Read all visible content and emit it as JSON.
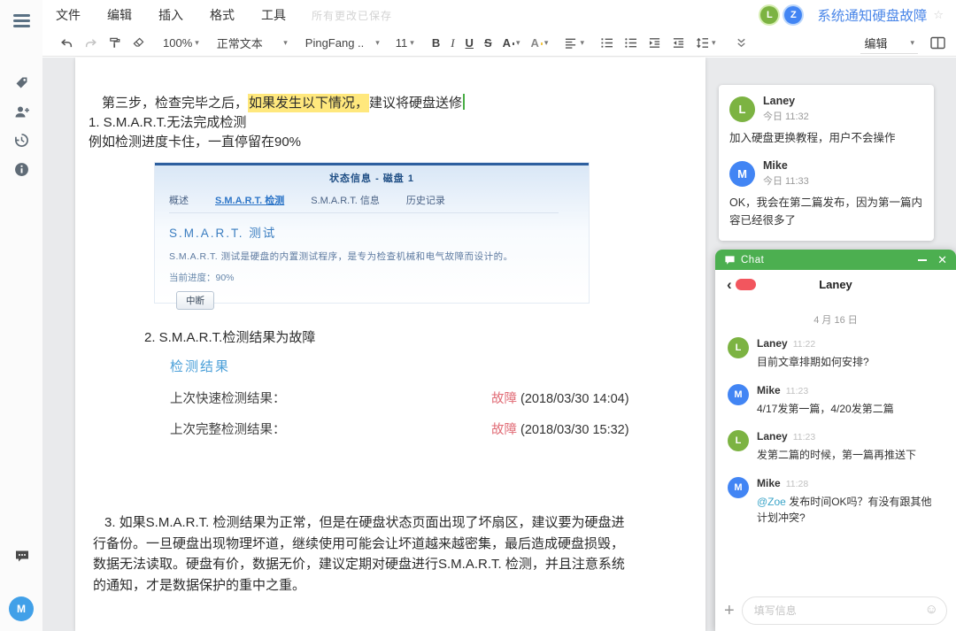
{
  "menu": {
    "items": [
      "文件",
      "编辑",
      "插入",
      "格式",
      "工具"
    ],
    "save_status": "所有更改已保存"
  },
  "titlebar": {
    "title": "系统通知硬盘故障",
    "collaborators": [
      {
        "initial": "L"
      },
      {
        "initial": "Z"
      }
    ]
  },
  "toolbar": {
    "zoom": "100%",
    "paragraph_style": "正常文本",
    "font_family": "PingFang ..",
    "font_size": "11",
    "bold": "B",
    "italic": "I",
    "underline": "U",
    "strikethrough": "S",
    "text_color": "A",
    "highlight": "A",
    "mode": "编辑"
  },
  "document": {
    "p1_pre": "第三步，检查完毕之后，",
    "p1_highlight": "如果发生以下情况，",
    "p1_post": "建议将硬盘送修",
    "p2": "1. S.M.A.R.T.无法完成检测",
    "p3": "例如检测进度卡住，一直停留在90%",
    "screenshot": {
      "window_title": "状态信息 - 磁盘 1",
      "tabs": [
        "概述",
        "S.M.A.R.T. 检测",
        "S.M.A.R.T. 信息",
        "历史记录"
      ],
      "selected_tab": "S.M.A.R.T. 检测",
      "heading": "S.M.A.R.T. 测试",
      "body": "S.M.A.R.T. 测试是硬盘的内置测试程序，是专为检查机械和电气故障而设计的。",
      "progress": "当前进度：90%",
      "button": "中断"
    },
    "p4": "2. S.M.A.R.T.检测结果为故障",
    "results": {
      "heading": "检测结果",
      "rows": [
        {
          "label": "上次快速检测结果：",
          "status": "故障",
          "time": " (2018/03/30 14:04)"
        },
        {
          "label": "上次完整检测结果：",
          "status": "故障",
          "time": " (2018/03/30 15:32)"
        }
      ]
    },
    "p5": "3. 如果S.M.A.R.T. 检测结果为正常，但是在硬盘状态页面出现了坏扇区，建议要为硬盘进行备份。一旦硬盘出现物理坏道，继续使用可能会让坏道越来越密集，最后造成硬盘损毁，数据无法读取。硬盘有价，数据无价，建议定期对硬盘进行S.M.A.R.T. 检测，并且注意系统的通知，才是数据保护的重中之重。"
  },
  "comments": {
    "items": [
      {
        "initial": "L",
        "author": "Laney",
        "time": "今日 11:32",
        "text": "加入硬盘更换教程，用户不会操作"
      },
      {
        "initial": "M",
        "author": "Mike",
        "time": "今日 11:33",
        "text": "OK，我会在第二篇发布，因为第一篇内容已经很多了"
      }
    ]
  },
  "chat": {
    "window_title": "Chat",
    "peer_name": "Laney",
    "date_divider": "4 月 16 日",
    "messages": [
      {
        "initial": "L",
        "author": "Laney",
        "time": "11:22",
        "mention": "",
        "text": "目前文章排期如何安排?"
      },
      {
        "initial": "M",
        "author": "Mike",
        "time": "11:23",
        "mention": "",
        "text": "4/17发第一篇，4/20发第二篇"
      },
      {
        "initial": "L",
        "author": "Laney",
        "time": "11:23",
        "mention": "",
        "text": "发第二篇的时候，第一篇再推送下"
      },
      {
        "initial": "M",
        "author": "Mike",
        "time": "11:28",
        "mention": "@Zoe",
        "text": " 发布时间OK吗？有没有跟其他计划冲突?"
      }
    ],
    "input_placeholder": "填写信息"
  },
  "rail": {
    "user_initial": "M"
  },
  "colors": {
    "accent_blue": "#4a86e8",
    "chat_green": "#4caf50",
    "laney_green": "#7cb342",
    "mike_blue": "#4285f4",
    "status_red": "#e06a74",
    "highlight_yellow": "#ffe87d"
  }
}
